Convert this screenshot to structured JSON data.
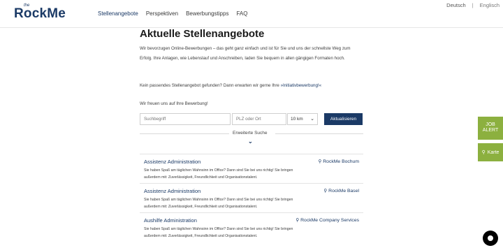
{
  "header": {
    "logo_small": "the",
    "logo_text": "RockMe",
    "nav": [
      "Stellenangebote",
      "Perspektiven",
      "Bewerbungstipps",
      "FAQ"
    ],
    "lang": {
      "de": "Deutsch",
      "sep": "|",
      "en": "Englisch"
    }
  },
  "main": {
    "title": "Aktuelle Stellenangebote",
    "intro": "Wir bevorzugen Online-Bewerbungen – das geht ganz einfach und ist für Sie und uns der schnellste Weg zum Erfolg. Ihre Anlagen, wie Lebenslauf und Anschreiben, laden Sie bequem in allen gängigen Formaten hoch.",
    "no_match_text": "Kein passendes Stellenangebot gefunden? Dann erwarten wir gerne Ihre ",
    "no_match_link": "»Initiativbewerbung!«",
    "apply_msg": "Wir freuen uns auf Ihre Bewerbung!"
  },
  "search": {
    "keyword_placeholder": "Suchbegriff",
    "location_placeholder": "PLZ oder Ort",
    "radius": "10 km",
    "update_label": "Aktualisieren",
    "advanced_label": "Erweiterte Suche"
  },
  "jobs": [
    {
      "title": "Assistenz Administration",
      "location": "RockMe Bochum",
      "desc": "Sie haben Spaß am täglichen Wahnsinn im Office? Dann sind Sie bei uns richtig! Sie bringen außerdem mit: Zuverlässigkeit, Freundlichkeit und Organisationstalent."
    },
    {
      "title": "Assistenz Administration",
      "location": "RockMe Basel",
      "desc": "Sie haben Spaß am täglichen Wahnsinn im Office? Dann sind Sie bei uns richtig! Sie bringen außerdem mit: Zuverlässigkeit, Freundlichkeit und Organisationstalent."
    },
    {
      "title": "Aushilfe Administration",
      "location": "RockMe Company Services",
      "desc": "Sie haben Spaß am täglichen Wahnsinn im Office? Dann sind Sie bei uns richtig! Sie bringen außerdem mit: Zuverlässigkeit, Freundlichkeit und Organisationstalent."
    }
  ],
  "side": {
    "job_alert_line1": "JOB",
    "job_alert_line2": "ALERT",
    "map_label": "Karte"
  },
  "colors": {
    "brand": "#1b3a66",
    "accent_green": "#8cb03f"
  }
}
